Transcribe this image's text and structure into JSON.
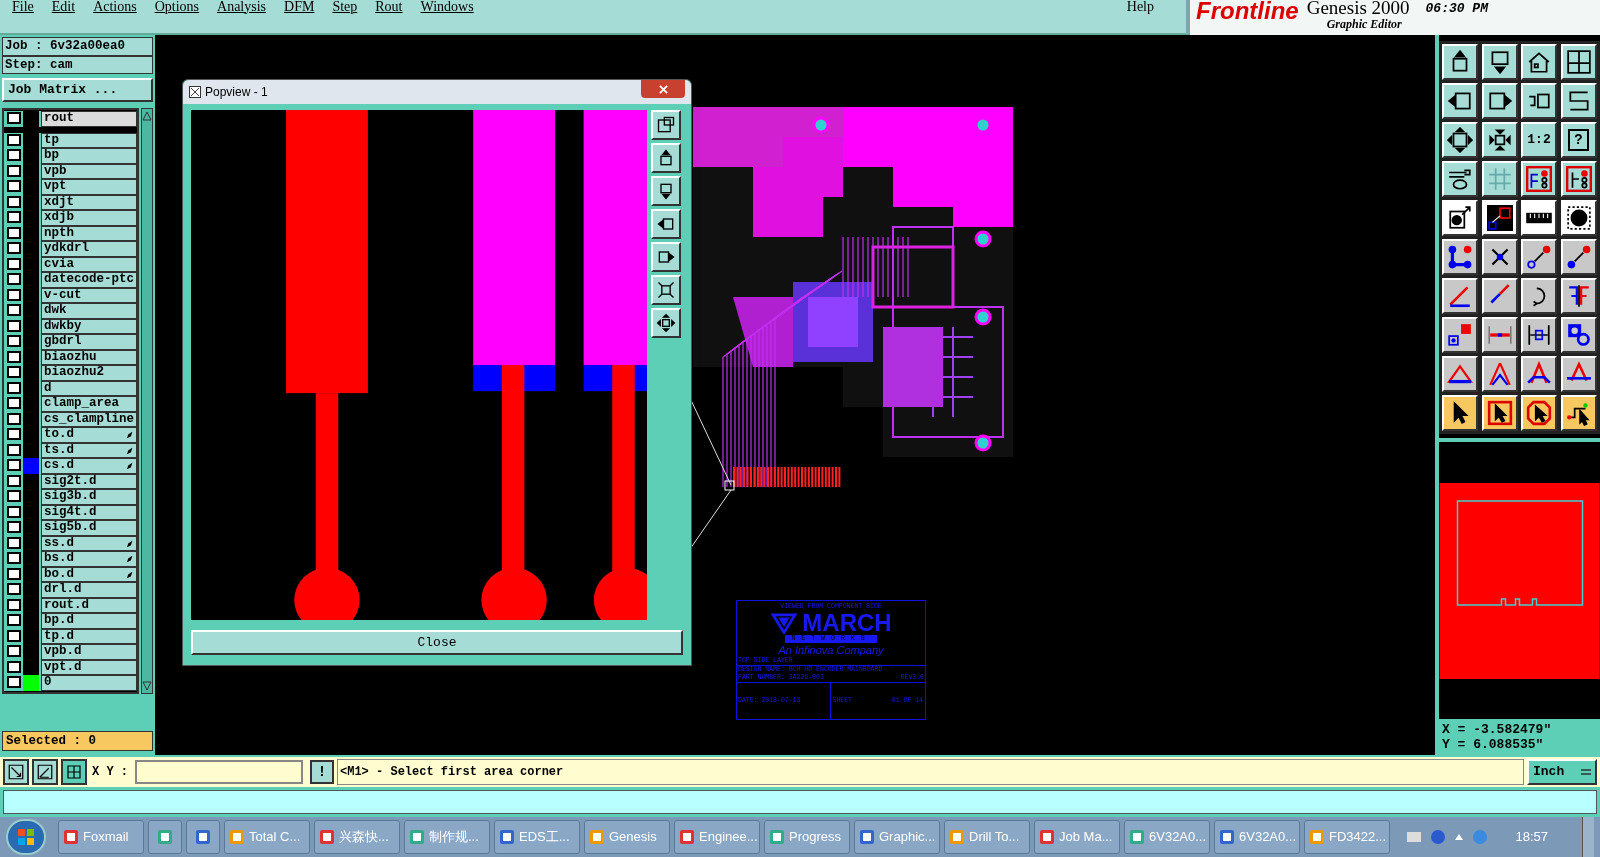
{
  "menu_bar": {
    "items": [
      "File",
      "Edit",
      "Actions",
      "Options",
      "Analysis",
      "DFM",
      "Step",
      "Rout",
      "Windows"
    ],
    "help": "Help"
  },
  "brand": {
    "logo": "Frontline",
    "product": "Genesis 2000",
    "subtitle": "Graphic Editor",
    "time": "06:30 PM"
  },
  "job_panel": {
    "job": "Job : 6v32a00ea0",
    "step": "Step: cam",
    "matrix_button": "Job Matrix ...",
    "selected_count": "Selected : 0",
    "layers": [
      {
        "name": "rout",
        "selected": true,
        "affected": false
      },
      {
        "name": "tp",
        "selected": false,
        "affected": false
      },
      {
        "name": "bp",
        "selected": false,
        "affected": false
      },
      {
        "name": "vpb",
        "selected": false,
        "affected": false
      },
      {
        "name": "vpt",
        "selected": false,
        "affected": false
      },
      {
        "name": "xdjt",
        "selected": false,
        "affected": false
      },
      {
        "name": "xdjb",
        "selected": false,
        "affected": false
      },
      {
        "name": "npth",
        "selected": false,
        "affected": false
      },
      {
        "name": "ydkdrl",
        "selected": false,
        "affected": false
      },
      {
        "name": "cvia",
        "selected": false,
        "affected": false
      },
      {
        "name": "datecode-ptc",
        "selected": false,
        "affected": false
      },
      {
        "name": "v-cut",
        "selected": false,
        "affected": false
      },
      {
        "name": "dwk",
        "selected": false,
        "affected": false
      },
      {
        "name": "dwkby",
        "selected": false,
        "affected": false
      },
      {
        "name": "gbdrl",
        "selected": false,
        "affected": false
      },
      {
        "name": "biaozhu",
        "selected": false,
        "affected": false
      },
      {
        "name": "biaozhu2",
        "selected": false,
        "affected": false
      },
      {
        "name": "d",
        "selected": false,
        "affected": false
      },
      {
        "name": "clamp_area",
        "selected": false,
        "affected": false
      },
      {
        "name": "cs_clampline",
        "selected": false,
        "affected": false
      },
      {
        "name": "to.d",
        "selected": false,
        "affected": true
      },
      {
        "name": "ts.d",
        "selected": false,
        "affected": true
      },
      {
        "name": "cs.d",
        "selected": false,
        "affected": true,
        "color": "#0000ff"
      },
      {
        "name": "sig2t.d",
        "selected": false,
        "affected": false
      },
      {
        "name": "sig3b.d",
        "selected": false,
        "affected": false
      },
      {
        "name": "sig4t.d",
        "selected": false,
        "affected": false
      },
      {
        "name": "sig5b.d",
        "selected": false,
        "affected": false
      },
      {
        "name": "ss.d",
        "selected": false,
        "affected": true
      },
      {
        "name": "bs.d",
        "selected": false,
        "affected": true
      },
      {
        "name": "bo.d",
        "selected": false,
        "affected": true
      },
      {
        "name": "drl.d",
        "selected": false,
        "affected": false
      },
      {
        "name": "rout.d",
        "selected": false,
        "affected": false
      },
      {
        "name": "bp.d",
        "selected": false,
        "affected": false
      },
      {
        "name": "tp.d",
        "selected": false,
        "affected": false
      },
      {
        "name": "vpb.d",
        "selected": false,
        "affected": false
      },
      {
        "name": "vpt.d",
        "selected": false,
        "affected": false
      },
      {
        "name": "0",
        "selected": false,
        "affected": false,
        "color": "#00ff00"
      }
    ]
  },
  "popview": {
    "title": "Popview - 1",
    "close_button": "Close"
  },
  "title_block": {
    "caption": "VIEWED FROM COMPONENT SIDE",
    "logo": "MARCH",
    "logo_sub": "NETWORKS",
    "tagline": "An Infinova Company",
    "layer": "TOP SIDE LAYER",
    "design_name": "DESIGN NAME: BCH HD ENCODER MAINBOARD",
    "part_number": "PART NUMBER: 3A226-003",
    "revision": "REV3.0",
    "date": "DATE: 2018-07-13",
    "sheet": "SHEET",
    "sheet_number": "01 OF 14"
  },
  "toolbar": {
    "ratio_button": "1:2",
    "help_button": "?"
  },
  "coordinates": {
    "x": "X = -3.582479\"",
    "y": "Y = 6.088535\""
  },
  "command_bar": {
    "label": "X Y :",
    "alert_button": "!",
    "message": "<M1> - Select first area corner",
    "units": "Inch"
  },
  "taskbar": {
    "clock": "18:57",
    "items": [
      {
        "kind": "app",
        "label": "Foxmail"
      },
      {
        "kind": "icon_only"
      },
      {
        "kind": "icon_only"
      },
      {
        "kind": "app",
        "label": "Total C..."
      },
      {
        "kind": "app",
        "label": "兴森快..."
      },
      {
        "kind": "app",
        "label": "制作规..."
      },
      {
        "kind": "app",
        "label": "EDS工..."
      },
      {
        "kind": "app",
        "label": "Genesis"
      },
      {
        "kind": "app",
        "label": "Enginee..."
      },
      {
        "kind": "app",
        "label": "Progress"
      },
      {
        "kind": "app",
        "label": "Graphic..."
      },
      {
        "kind": "app",
        "label": "Drill To..."
      },
      {
        "kind": "app",
        "label": "Job Ma..."
      },
      {
        "kind": "app",
        "label": "6V32A0..."
      },
      {
        "kind": "app",
        "label": "6V32A0..."
      },
      {
        "kind": "app",
        "label": "FD3422..."
      }
    ]
  }
}
